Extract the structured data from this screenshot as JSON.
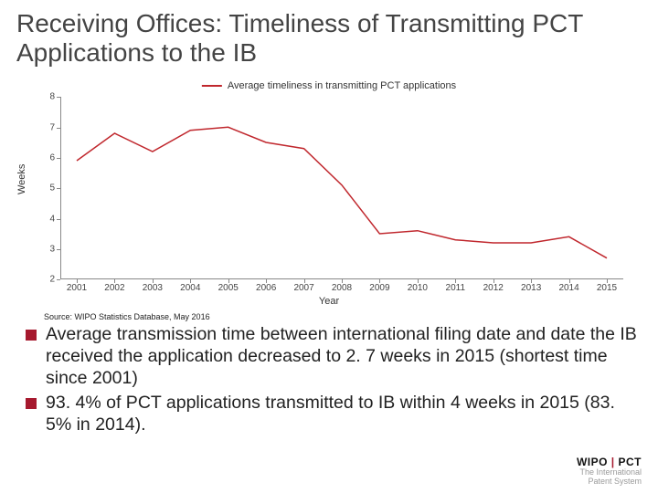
{
  "title": "Receiving Offices:  Timeliness of Transmitting PCT Applications to the IB",
  "legend": "Average timeliness in transmitting PCT applications",
  "ylabel": "Weeks",
  "xlabel": "Year",
  "source": "Source: WIPO Statistics Database, May 2016",
  "bullets": [
    "Average transmission time between international filing date and date the IB received the application decreased to 2. 7 weeks in 2015 (shortest time since 2001)",
    "93. 4% of PCT applications transmitted to IB within 4 weeks in 2015 (83. 5% in 2014)."
  ],
  "footer": {
    "brand1": "WIPO",
    "brand2": "PCT",
    "tag1": "The International",
    "tag2": "Patent System"
  },
  "chart_data": {
    "type": "line",
    "title": "",
    "xlabel": "Year",
    "ylabel": "Weeks",
    "ylim": [
      2,
      8
    ],
    "categories": [
      "2001",
      "2002",
      "2003",
      "2004",
      "2005",
      "2006",
      "2007",
      "2008",
      "2009",
      "2010",
      "2011",
      "2012",
      "2013",
      "2014",
      "2015"
    ],
    "series": [
      {
        "name": "Average timeliness in transmitting PCT applications",
        "values": [
          5.9,
          6.8,
          6.2,
          6.9,
          7.0,
          6.5,
          6.3,
          5.1,
          3.5,
          3.6,
          3.3,
          3.2,
          3.2,
          3.4,
          2.7
        ]
      }
    ],
    "legend_position": "top-center",
    "grid": false
  }
}
